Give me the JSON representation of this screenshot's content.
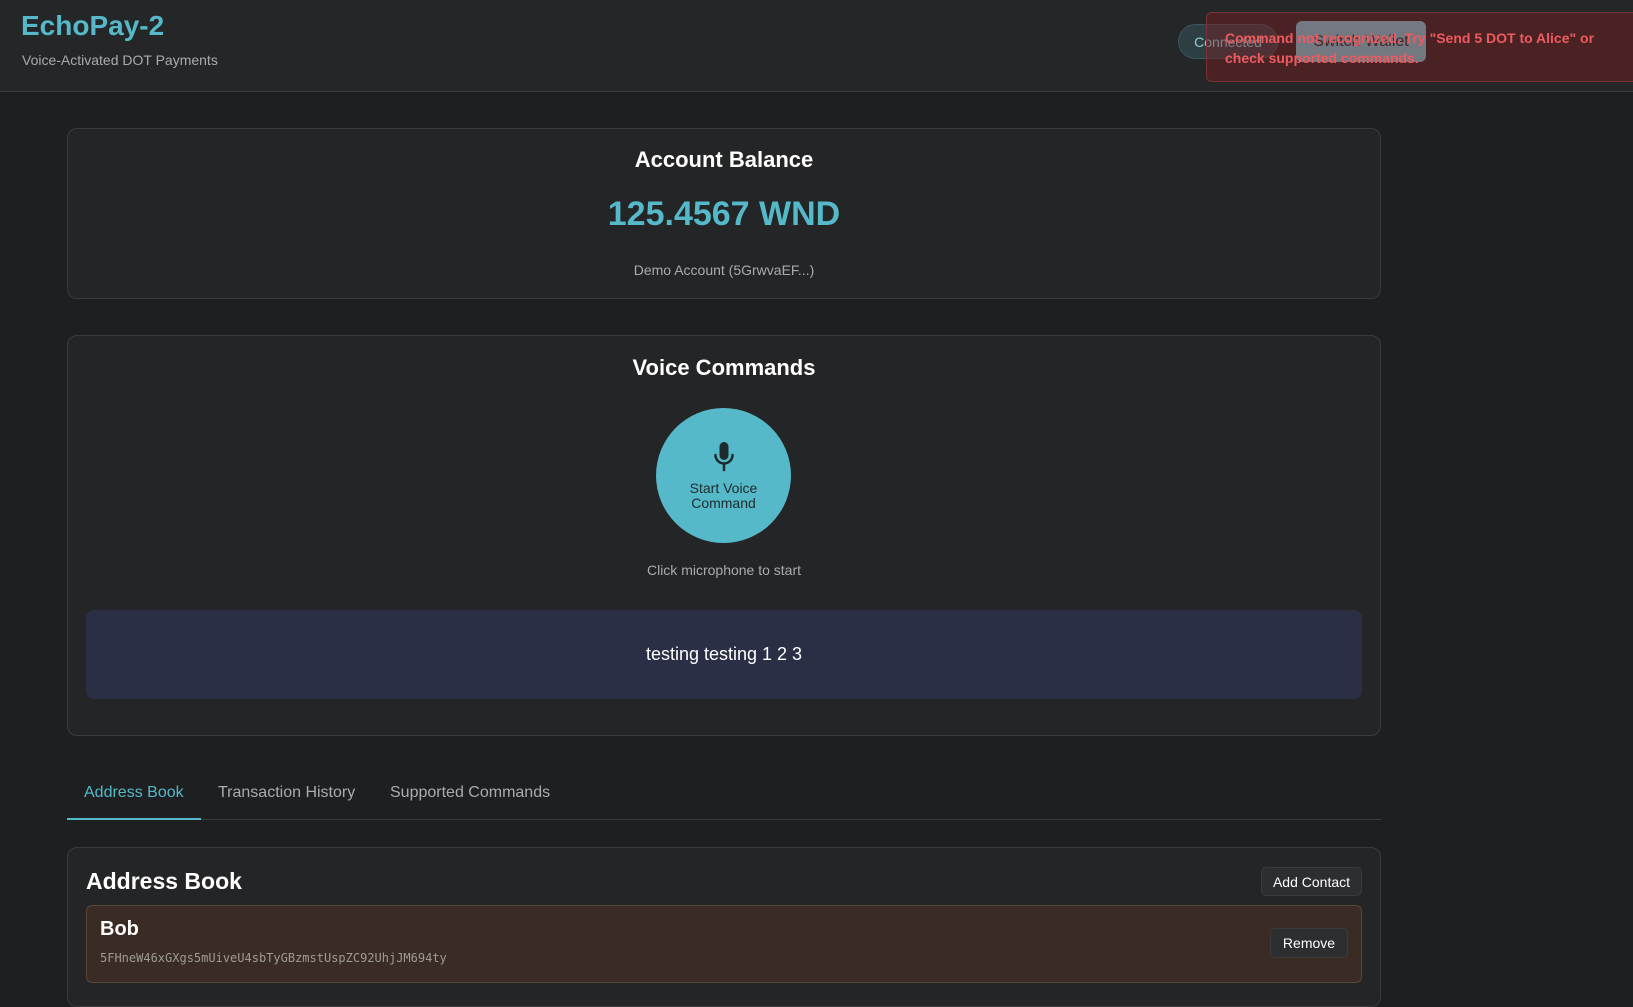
{
  "header": {
    "title": "EchoPay-2",
    "subtitle": "Voice-Activated DOT Payments",
    "status": "Connected",
    "switch_wallet_label": "Switch Wallet"
  },
  "toast": {
    "message": "Command not recognized. Try \"Send 5 DOT to Alice\" or check supported commands.",
    "color": "#ef5a5f"
  },
  "balance": {
    "title": "Account Balance",
    "value": "125.4567 WND",
    "account": "Demo Account (5GrwvaEF...)"
  },
  "voice": {
    "title": "Voice Commands",
    "mic_icon": "microphone-icon",
    "button_label": "Start Voice Command",
    "hint": "Click microphone to start",
    "transcript": "testing testing 1 2 3"
  },
  "tabs": [
    {
      "label": "Address Book",
      "active": true
    },
    {
      "label": "Transaction History",
      "active": false
    },
    {
      "label": "Supported Commands",
      "active": false
    }
  ],
  "address_book": {
    "title": "Address Book",
    "add_contact_label": "Add Contact",
    "contacts": [
      {
        "name": "Bob",
        "address": "5FHneW46xGXgs5mUiveU4sbTyGBzmstUspZC92UhjJM694ty",
        "remove_label": "Remove"
      }
    ]
  },
  "colors": {
    "accent": "#55b9c9",
    "background": "#1e1f20",
    "error": "#ef5a5f"
  }
}
